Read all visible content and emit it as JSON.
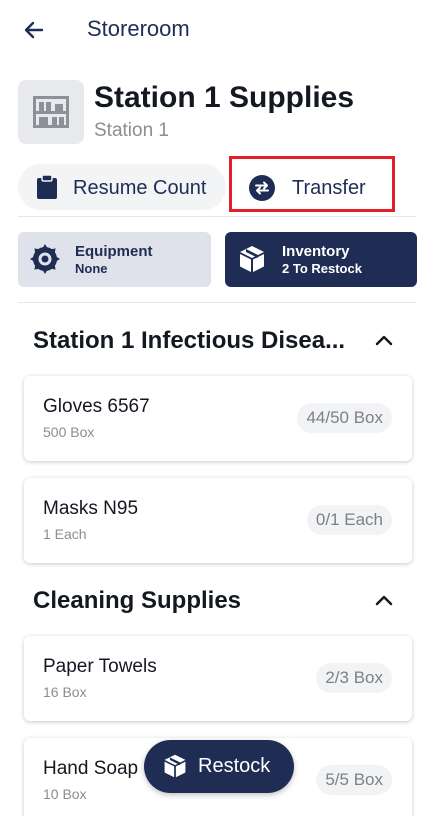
{
  "topbar": {
    "title": "Storeroom"
  },
  "header": {
    "title": "Station 1 Supplies",
    "subtitle": "Station 1"
  },
  "actions": {
    "resume_label": "Resume Count",
    "transfer_label": "Transfer"
  },
  "tabs": [
    {
      "title": "Equipment",
      "sub": "None",
      "icon": "saw-blade-icon",
      "selected": false
    },
    {
      "title": "Inventory",
      "sub": "2 To Restock",
      "icon": "box-icon",
      "selected": true
    }
  ],
  "sections": [
    {
      "title": "Station 1 Infectious Disea...",
      "expanded": true,
      "items": [
        {
          "name": "Gloves 6567",
          "unit": "500 Box",
          "count": "44/50 Box"
        },
        {
          "name": "Masks N95",
          "unit": "1 Each",
          "count": "0/1 Each"
        }
      ]
    },
    {
      "title": "Cleaning Supplies",
      "expanded": true,
      "items": [
        {
          "name": "Paper Towels",
          "unit": "16 Box",
          "count": "2/3 Box"
        },
        {
          "name": "Hand Soap",
          "unit": "10 Box",
          "count": "5/5 Box"
        }
      ]
    }
  ],
  "fab": {
    "label": "Restock"
  },
  "colors": {
    "primary": "#1f2d55",
    "highlight": "#e2202a",
    "muted": "#8b8d95",
    "chip_bg": "#f2f3f5"
  }
}
